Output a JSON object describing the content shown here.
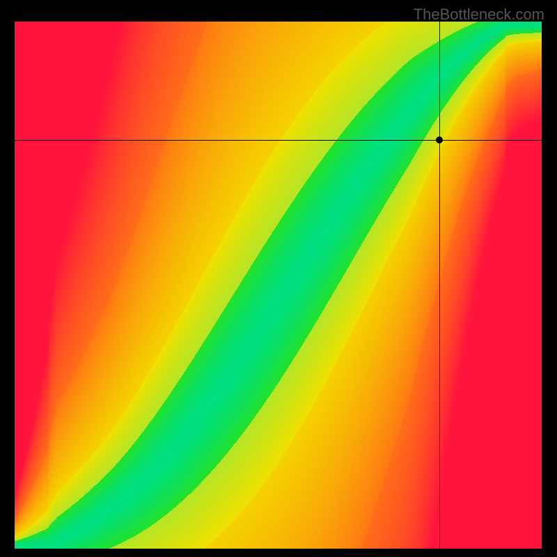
{
  "watermark": "TheBottleneck.com",
  "chart_data": {
    "type": "heatmap",
    "title": "",
    "xlabel": "",
    "ylabel": "",
    "x_range": [
      0,
      100
    ],
    "y_range": [
      0,
      100
    ],
    "color_scale": {
      "optimal": "#00E080",
      "near": "#E8E800",
      "mid": "#FF9000",
      "poor": "#FF1030"
    },
    "ridge_notes": "Green band follows an S-shaped curve from bottom-left to top-right; band width narrows toward the top-right.",
    "marker": {
      "x": 80.5,
      "y": 77.5,
      "note": "Black crosshair dot on the right edge of green band"
    },
    "crosshair": {
      "x_fraction": 0.806,
      "y_fraction": 0.225
    }
  }
}
